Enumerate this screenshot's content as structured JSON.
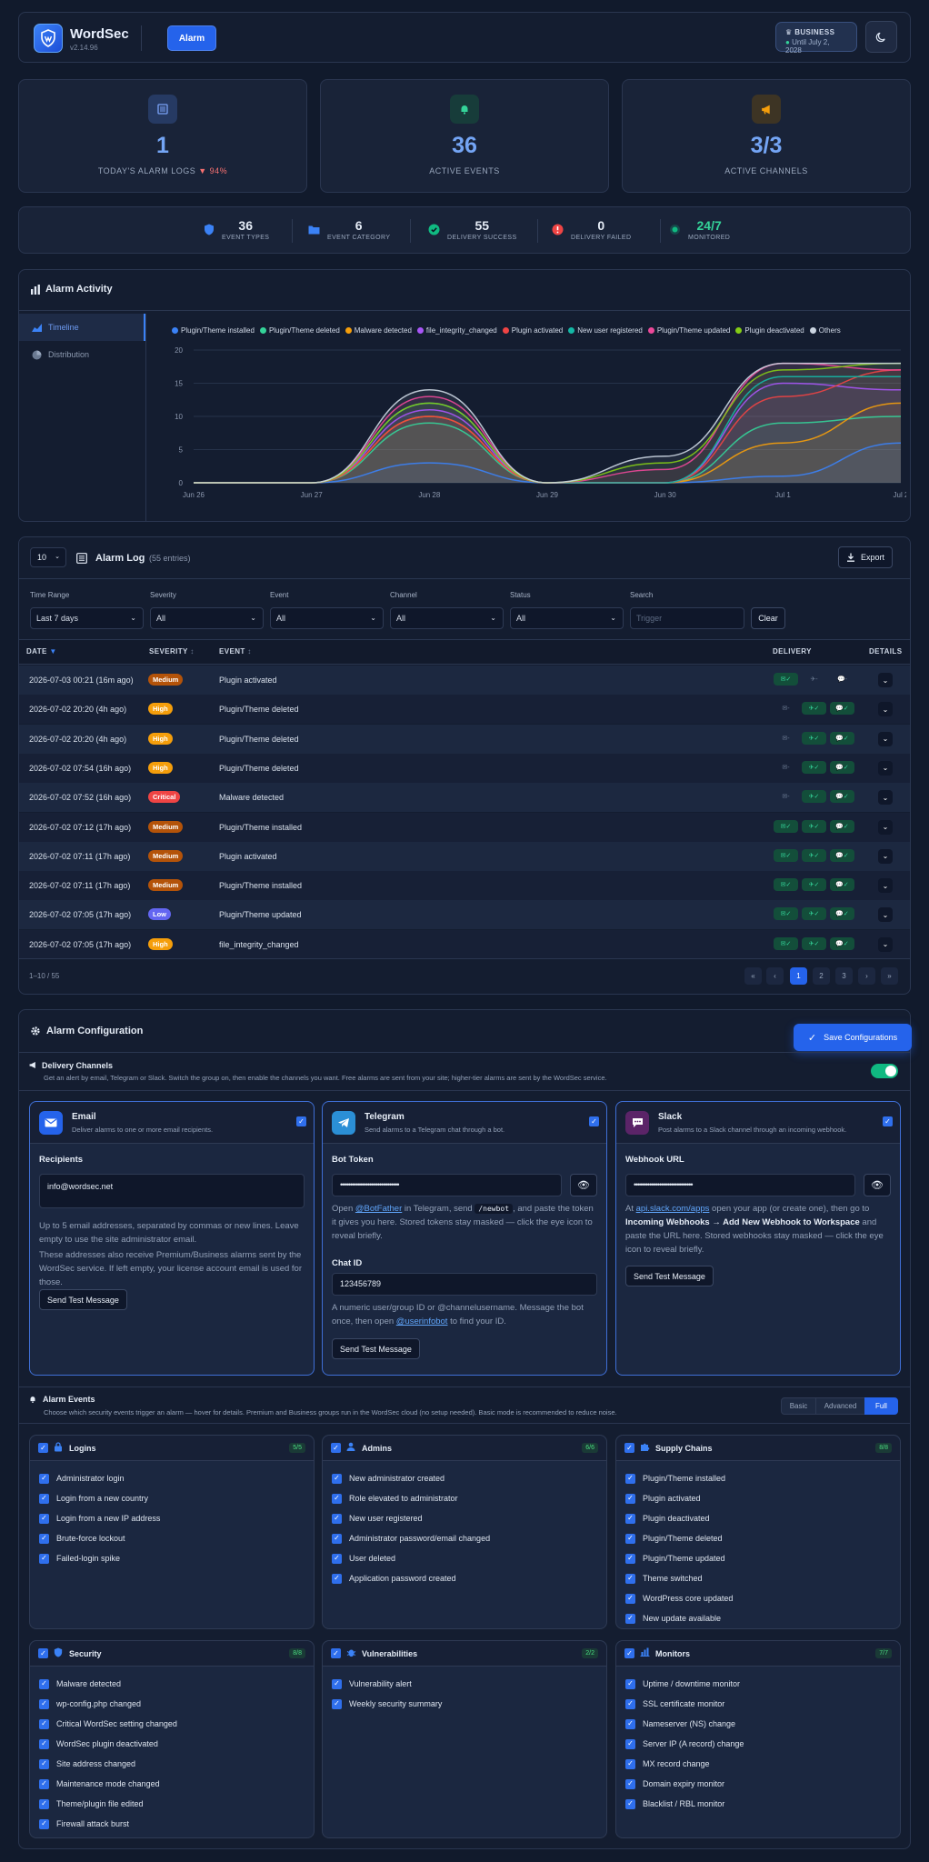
{
  "header": {
    "brand": "WordSec",
    "version": "v2.14.96",
    "nav_alarm": "Alarm",
    "plan": {
      "tier": "BUSINESS",
      "until": "Until July 2, 2028"
    }
  },
  "stats": [
    {
      "value": "1",
      "label": "TODAY'S ALARM LOGS",
      "delta": "94%",
      "icon": "list-icon",
      "color": "#7aa2f7"
    },
    {
      "value": "36",
      "label": "ACTIVE EVENTS",
      "icon": "bell-icon",
      "color": "#34d399"
    },
    {
      "value": "3/3",
      "label": "ACTIVE CHANNELS",
      "icon": "megaphone-icon",
      "color": "#f59e0b"
    }
  ],
  "mini_stats": [
    {
      "value": "36",
      "label": "EVENT TYPES",
      "icon": "shield-icon",
      "color": "#3b82f6"
    },
    {
      "value": "6",
      "label": "EVENT CATEGORY",
      "icon": "folder-icon",
      "color": "#3b82f6"
    },
    {
      "value": "55",
      "label": "DELIVERY SUCCESS",
      "icon": "check-circle-icon",
      "color": "#10b981"
    },
    {
      "value": "0",
      "label": "DELIVERY FAILED",
      "icon": "alert-circle-icon",
      "color": "#ef4444"
    },
    {
      "value": "24/7",
      "label": "MONITORED",
      "icon": "pulse-dot-icon",
      "color": "#10b981"
    }
  ],
  "activity": {
    "title": "Alarm Activity",
    "tabs": [
      "Timeline",
      "Distribution"
    ]
  },
  "chart_data": {
    "type": "area",
    "x": [
      "Jun 26",
      "Jun 27",
      "Jun 28",
      "Jun 29",
      "Jun 30",
      "Jul 1",
      "Jul 2"
    ],
    "ylim": [
      0,
      20
    ],
    "yticks": [
      0,
      5,
      10,
      15,
      20
    ],
    "series": [
      {
        "name": "Plugin/Theme installed",
        "color": "#3b82f6",
        "values": [
          0,
          0,
          3,
          0,
          0,
          1,
          6
        ]
      },
      {
        "name": "Plugin/Theme deleted",
        "color": "#34d399",
        "values": [
          0,
          0,
          9,
          0,
          0,
          9,
          10
        ]
      },
      {
        "name": "Malware detected",
        "color": "#f59e0b",
        "values": [
          0,
          0,
          10,
          0,
          0,
          6,
          12
        ]
      },
      {
        "name": "file_integrity_changed",
        "color": "#a855f7",
        "values": [
          0,
          0,
          11,
          0,
          0,
          15,
          14
        ]
      },
      {
        "name": "Plugin activated",
        "color": "#ef4444",
        "values": [
          0,
          0,
          10,
          0,
          0,
          13,
          17
        ]
      },
      {
        "name": "New user registered",
        "color": "#14b8a6",
        "values": [
          0,
          0,
          12,
          0,
          0,
          16,
          16
        ]
      },
      {
        "name": "Plugin/Theme updated",
        "color": "#ec4899",
        "values": [
          0,
          0,
          13,
          0,
          2,
          18,
          17
        ]
      },
      {
        "name": "Plugin deactivated",
        "color": "#84cc16",
        "values": [
          0,
          0,
          12,
          0,
          3,
          17,
          18
        ]
      },
      {
        "name": "Others",
        "color": "#cbd5e1",
        "values": [
          0,
          0,
          14,
          0,
          4,
          18,
          18
        ]
      }
    ]
  },
  "log": {
    "per_page": "10",
    "title": "Alarm Log",
    "count": "(55 entries)",
    "export": "Export",
    "filters": [
      {
        "label": "Time Range",
        "value": "Last 7 days"
      },
      {
        "label": "Severity",
        "value": "All"
      },
      {
        "label": "Event",
        "value": "All"
      },
      {
        "label": "Channel",
        "value": "All"
      },
      {
        "label": "Status",
        "value": "All"
      }
    ],
    "search_label": "Search",
    "search_placeholder": "Trigger",
    "clear": "Clear",
    "columns": [
      "DATE",
      "SEVERITY",
      "EVENT",
      "DELIVERY",
      "DETAILS"
    ],
    "rows": [
      {
        "date": "2026-07-03 00:21 (16m ago)",
        "severity": "Medium",
        "event": "Plugin activated",
        "d": [
          1,
          0,
          0
        ]
      },
      {
        "date": "2026-07-02 20:20 (4h ago)",
        "severity": "High",
        "event": "Plugin/Theme deleted",
        "d": [
          0,
          1,
          1
        ]
      },
      {
        "date": "2026-07-02 20:20 (4h ago)",
        "severity": "High",
        "event": "Plugin/Theme deleted",
        "d": [
          0,
          1,
          1
        ]
      },
      {
        "date": "2026-07-02 07:54 (16h ago)",
        "severity": "High",
        "event": "Plugin/Theme deleted",
        "d": [
          0,
          1,
          1
        ]
      },
      {
        "date": "2026-07-02 07:52 (16h ago)",
        "severity": "Critical",
        "event": "Malware detected",
        "d": [
          0,
          1,
          1
        ]
      },
      {
        "date": "2026-07-02 07:12 (17h ago)",
        "severity": "Medium",
        "event": "Plugin/Theme installed",
        "d": [
          1,
          1,
          1
        ]
      },
      {
        "date": "2026-07-02 07:11 (17h ago)",
        "severity": "Medium",
        "event": "Plugin activated",
        "d": [
          1,
          1,
          1
        ]
      },
      {
        "date": "2026-07-02 07:11 (17h ago)",
        "severity": "Medium",
        "event": "Plugin/Theme installed",
        "d": [
          1,
          1,
          1
        ]
      },
      {
        "date": "2026-07-02 07:05 (17h ago)",
        "severity": "Low",
        "event": "Plugin/Theme updated",
        "d": [
          1,
          1,
          1
        ]
      },
      {
        "date": "2026-07-02 07:05 (17h ago)",
        "severity": "High",
        "event": "file_integrity_changed",
        "d": [
          1,
          1,
          1
        ]
      }
    ],
    "range": "1–10 / 55",
    "pages": [
      "«",
      "‹",
      "1",
      "2",
      "3",
      "›",
      "»"
    ]
  },
  "config": {
    "title": "Alarm Configuration",
    "save": "Save Configurations",
    "delivery_title": "Delivery Channels",
    "delivery_desc": "Get an alert by email, Telegram or Slack. Switch the group on, then enable the channels you want. Free alarms are sent from your site; higher-tier alarms are sent by the WordSec service.",
    "email": {
      "name": "Email",
      "desc": "Deliver alarms to one or more email recipients.",
      "field": "Recipients",
      "value": "info@wordsec.net",
      "help1": "Up to 5 email addresses, separated by commas or new lines. Leave empty to use the site administrator email.",
      "help2": "These addresses also receive Premium/Business alarms sent by the WordSec service. If left empty, your license account email is used for those.",
      "test": "Send Test Message"
    },
    "telegram": {
      "name": "Telegram",
      "desc": "Send alarms to a Telegram chat through a bot.",
      "field": "Bot Token",
      "value": "••••••••••••••••••••••••••••••",
      "help_a": "Open ",
      "help_link": "@BotFather",
      "help_b": " in Telegram, send ",
      "help_code": "/newbot",
      "help_c": ", and paste the token it gives you here. Stored tokens stay masked — click the eye icon to reveal briefly.",
      "field2": "Chat ID",
      "value2": "123456789",
      "help2_a": "A numeric user/group ID or @channelusername. Message the bot once, then open ",
      "help2_link": "@userinfobot",
      "help2_b": " to find your ID.",
      "test": "Send Test Message"
    },
    "slack": {
      "name": "Slack",
      "desc": "Post alarms to a Slack channel through an incoming webhook.",
      "field": "Webhook URL",
      "value": "••••••••••••••••••••••••••••••",
      "help_a": "At ",
      "help_link": "api.slack.com/apps",
      "help_b": " open your app (or create one), then go to ",
      "help_bold": "Incoming Webhooks → Add New Webhook to Workspace",
      "help_c": " and paste the URL here. Stored webhooks stay masked — click the eye icon to reveal briefly.",
      "test": "Send Test Message"
    },
    "events_title": "Alarm Events",
    "events_desc": "Choose which security events trigger an alarm — hover for details. Premium and Business groups run in the WordSec cloud (no setup needed). Basic mode is recommended to reduce noise.",
    "modes": [
      "Basic",
      "Advanced",
      "Full"
    ],
    "groups": [
      {
        "name": "Logins",
        "count": "5/5",
        "icon": "lock-icon",
        "items": [
          "Administrator login",
          "Login from a new country",
          "Login from a new IP address",
          "Brute-force lockout",
          "Failed-login spike"
        ]
      },
      {
        "name": "Admins",
        "count": "6/6",
        "icon": "user-icon",
        "items": [
          "New administrator created",
          "Role elevated to administrator",
          "New user registered",
          "Administrator password/email changed",
          "User deleted",
          "Application password created"
        ]
      },
      {
        "name": "Supply Chains",
        "count": "8/8",
        "icon": "puzzle-icon",
        "items": [
          "Plugin/Theme installed",
          "Plugin activated",
          "Plugin deactivated",
          "Plugin/Theme deleted",
          "Plugin/Theme updated",
          "Theme switched",
          "WordPress core updated",
          "New update available"
        ]
      },
      {
        "name": "Security",
        "count": "8/8",
        "icon": "shield-icon",
        "items": [
          "Malware detected",
          "wp-config.php changed",
          "Critical WordSec setting changed",
          "WordSec plugin deactivated",
          "Site address changed",
          "Maintenance mode changed",
          "Theme/plugin file edited",
          "Firewall attack burst"
        ]
      },
      {
        "name": "Vulnerabilities",
        "count": "2/2",
        "icon": "bug-icon",
        "items": [
          "Vulnerability alert",
          "Weekly security summary"
        ]
      },
      {
        "name": "Monitors",
        "count": "7/7",
        "icon": "chart-icon",
        "items": [
          "Uptime / downtime monitor",
          "SSL certificate monitor",
          "Nameserver (NS) change",
          "Server IP (A record) change",
          "MX record change",
          "Domain expiry monitor",
          "Blacklist / RBL monitor"
        ]
      }
    ]
  }
}
